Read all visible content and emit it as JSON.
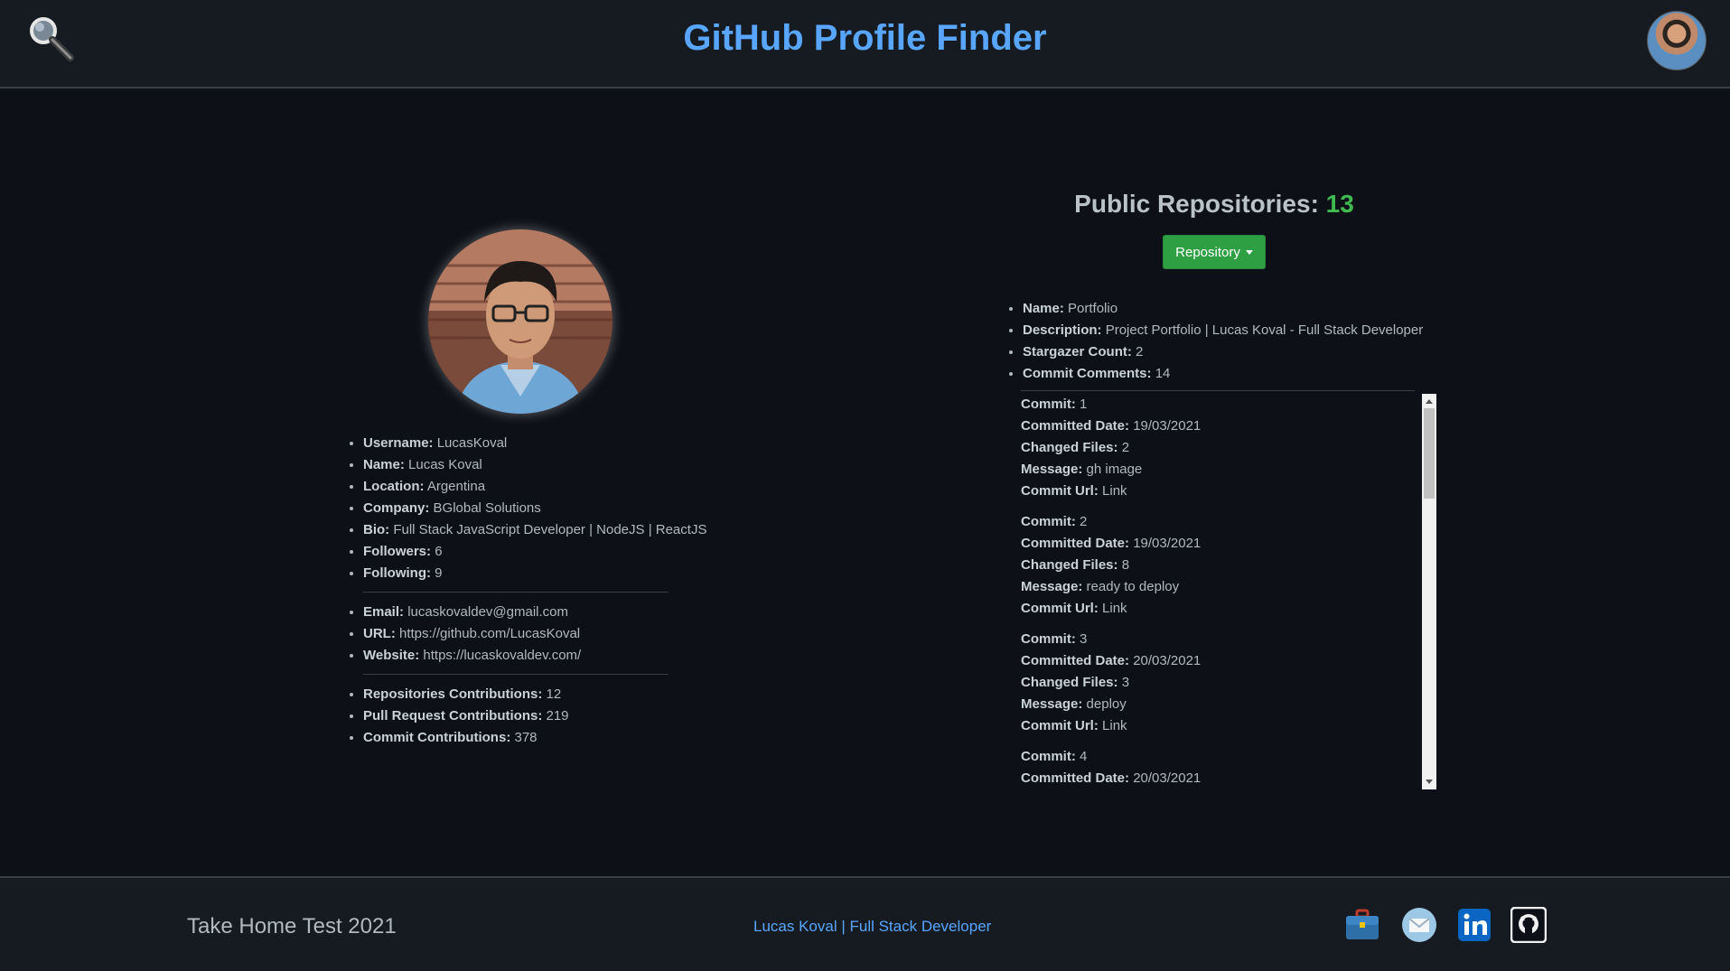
{
  "header": {
    "title": "GitHub Profile Finder"
  },
  "profile": {
    "items": [
      {
        "label": "Username:",
        "value": "LucasKoval"
      },
      {
        "label": "Name:",
        "value": "Lucas Koval"
      },
      {
        "label": "Location:",
        "value": "Argentina"
      },
      {
        "label": "Company:",
        "value": "BGlobal Solutions"
      },
      {
        "label": "Bio:",
        "value": "Full Stack JavaScript Developer | NodeJS | ReactJS"
      },
      {
        "label": "Followers:",
        "value": "6"
      },
      {
        "label": "Following:",
        "value": "9"
      }
    ],
    "contact": [
      {
        "label": "Email:",
        "value": "lucaskovaldev@gmail.com"
      },
      {
        "label": "URL:",
        "value": "https://github.com/LucasKoval"
      },
      {
        "label": "Website:",
        "value": "https://lucaskovaldev.com/"
      }
    ],
    "contributions": [
      {
        "label": "Repositories Contributions:",
        "value": "12"
      },
      {
        "label": "Pull Request Contributions:",
        "value": "219"
      },
      {
        "label": "Commit Contributions:",
        "value": "378"
      }
    ]
  },
  "repos": {
    "heading": "Public Repositories:",
    "count": "13",
    "button_label": "Repository",
    "details": [
      {
        "label": "Name:",
        "value": "Portfolio"
      },
      {
        "label": "Description:",
        "value": "Project Portfolio | Lucas Koval - Full Stack Developer"
      },
      {
        "label": "Stargazer Count:",
        "value": "2"
      },
      {
        "label": "Commit Comments:",
        "value": "14"
      }
    ],
    "commit_labels": {
      "commit": "Commit:",
      "date": "Committed Date:",
      "files": "Changed Files:",
      "message": "Message:",
      "url": "Commit Url:"
    },
    "commits": [
      {
        "commit": "1",
        "date": "19/03/2021",
        "files": "2",
        "message": "gh image",
        "url": "Link"
      },
      {
        "commit": "2",
        "date": "19/03/2021",
        "files": "8",
        "message": "ready to deploy",
        "url": "Link"
      },
      {
        "commit": "3",
        "date": "20/03/2021",
        "files": "3",
        "message": "deploy",
        "url": "Link"
      },
      {
        "commit": "4",
        "date": "20/03/2021"
      }
    ]
  },
  "footer": {
    "left_text": "Take Home Test 2021",
    "center_link": "Lucas Koval | Full Stack Developer",
    "social": [
      "briefcase-icon",
      "mail-icon",
      "linkedin-icon",
      "github-icon"
    ]
  },
  "colors": {
    "background": "#0d1117",
    "bar": "#161b22",
    "accent_blue": "#58a6ff",
    "accent_green": "#2ea043"
  }
}
